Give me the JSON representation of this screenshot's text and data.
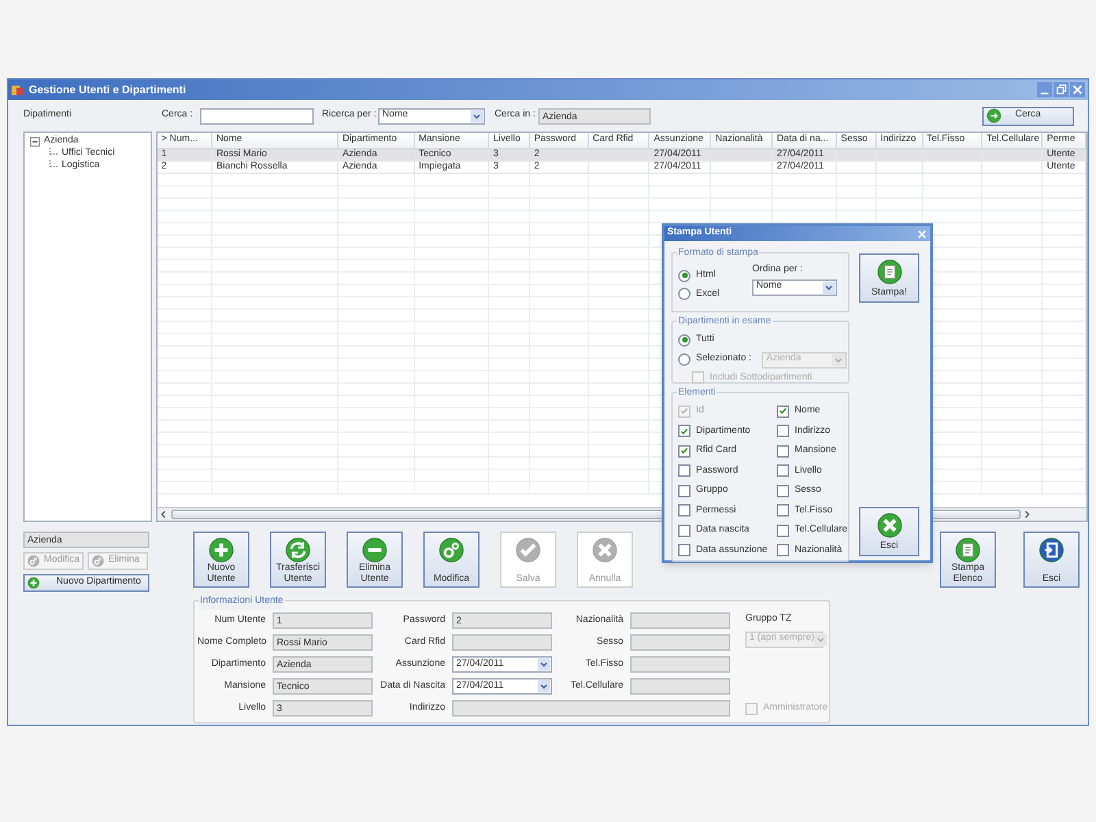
{
  "window": {
    "title": "Gestione Utenti e Dipartimenti"
  },
  "toolbar": {
    "departments_label": "Dipatimenti",
    "search_label": "Cerca :",
    "search_by_label": "Ricerca per :",
    "search_by_value": "Nome",
    "search_in_label": "Cerca in :",
    "search_in_value": "Azienda",
    "search_button": "Cerca"
  },
  "tree": [
    {
      "label": "Azienda",
      "expanded": true,
      "children": [
        {
          "label": "Uffici Tecnici"
        },
        {
          "label": "Logistica"
        }
      ]
    }
  ],
  "table": {
    "columns": [
      "> Num...",
      "Nome",
      "Dipartimento",
      "Mansione",
      "Livello",
      "Password",
      "Card Rfid",
      "Assunzione",
      "Nazionalità",
      "Data di na...",
      "Sesso",
      "Indirizzo",
      "Tel.Fisso",
      "Tel.Cellulare",
      "Perme"
    ],
    "rows": [
      {
        "selected": true,
        "cells": [
          "1",
          "Rossi Mario",
          "Azienda",
          "Tecnico",
          "3",
          "2",
          null,
          "27/04/2011",
          null,
          "27/04/2011",
          null,
          null,
          null,
          null,
          "Utente"
        ]
      },
      {
        "selected": false,
        "cells": [
          "2",
          "Bianchi Rossella",
          "Azienda",
          "Impiegata",
          "3",
          "2",
          null,
          "27/04/2011",
          null,
          "27/04/2011",
          null,
          null,
          null,
          null,
          "Utente"
        ]
      }
    ]
  },
  "department_panel": {
    "value": "Azienda",
    "buttons": [
      {
        "label": "Modifica",
        "disabled": true
      },
      {
        "label": "Elimina",
        "disabled": true
      },
      {
        "label": "Nuovo Dipartimento",
        "disabled": false
      }
    ]
  },
  "actions": [
    {
      "label": "Nuovo Utente",
      "kind": "plus",
      "disabled": false
    },
    {
      "label": "Trasferisci Utente",
      "kind": "swap",
      "disabled": false
    },
    {
      "label": "Elimina Utente",
      "kind": "minus",
      "disabled": false
    },
    {
      "label": "Modifica",
      "kind": "gear",
      "disabled": false
    },
    {
      "label": "Salva",
      "kind": "check",
      "disabled": true
    },
    {
      "label": "Annulla",
      "kind": "cross",
      "disabled": true
    }
  ],
  "right_actions": [
    {
      "label": "Stampa Elenco",
      "kind": "print",
      "disabled": false
    },
    {
      "label": "Esci",
      "kind": "exit",
      "disabled": false
    }
  ],
  "user_info": {
    "title": "Informazioni Utente",
    "column_1": [
      {
        "label": "Num Utente",
        "value": "1",
        "kind": "text"
      },
      {
        "label": "Nome Completo",
        "value": "Rossi Mario",
        "kind": "text"
      },
      {
        "label": "Dipartimento",
        "value": "Azienda",
        "kind": "text"
      },
      {
        "label": "Mansione",
        "value": "Tecnico",
        "kind": "text"
      },
      {
        "label": "Livello",
        "value": "3",
        "kind": "text"
      }
    ],
    "column_2": [
      {
        "label": "Password",
        "value": "2",
        "kind": "text"
      },
      {
        "label": "Card Rfid",
        "kind": "text"
      },
      {
        "label": "Assunzione",
        "value": "27/04/2011",
        "kind": "date"
      },
      {
        "label": "Data di Nascita",
        "value": "27/04/2011",
        "kind": "date"
      },
      {
        "label": "Indirizzo",
        "kind": "wide"
      }
    ],
    "column_3": [
      {
        "label": "Nazionalità",
        "kind": "text"
      },
      {
        "label": "Sesso",
        "kind": "text"
      },
      {
        "label": "Tel.Fisso",
        "kind": "text"
      },
      {
        "label": "Tel.Cellulare",
        "kind": "text"
      }
    ],
    "group_tz": {
      "label": "Gruppo TZ",
      "value": "1 (apri sempre)",
      "disabled": true
    },
    "admin": {
      "label": "Amministratore",
      "checked": false,
      "disabled": true
    }
  },
  "print_dialog": {
    "title": "Stampa Utenti",
    "format": {
      "title": "Formato di stampa",
      "options": [
        {
          "label": "Html",
          "selected": true
        },
        {
          "label": "Excel",
          "selected": false
        }
      ],
      "order_label": "Ordina per :",
      "order_value": "Nome"
    },
    "departments": {
      "title": "Dipartimenti in esame",
      "options": [
        {
          "label": "Tutti",
          "selected": true
        },
        {
          "label": "Selezionato :",
          "selected": false
        }
      ],
      "department_value": "Azienda",
      "department_disabled": true,
      "include_sub": {
        "label": "Includi Sottodipartimenti",
        "checked": false,
        "disabled": true
      }
    },
    "elements": {
      "title": "Elementi",
      "items": [
        {
          "label": "Id",
          "checked": true,
          "disabled": true
        },
        {
          "label": "Nome",
          "checked": true,
          "disabled": false
        },
        {
          "label": "Dipartimento",
          "checked": true,
          "disabled": false
        },
        {
          "label": "Indirizzo",
          "checked": false,
          "disabled": false
        },
        {
          "label": "Rfid Card",
          "checked": true,
          "disabled": false
        },
        {
          "label": "Mansione",
          "checked": false,
          "disabled": false
        },
        {
          "label": "Password",
          "checked": false,
          "disabled": false
        },
        {
          "label": "Livello",
          "checked": false,
          "disabled": false
        },
        {
          "label": "Gruppo",
          "checked": false,
          "disabled": false
        },
        {
          "label": "Sesso",
          "checked": false,
          "disabled": false
        },
        {
          "label": "Permessi",
          "checked": false,
          "disabled": false
        },
        {
          "label": "Tel.Fisso",
          "checked": false,
          "disabled": false
        },
        {
          "label": "Data nascita",
          "checked": false,
          "disabled": false
        },
        {
          "label": "Tel.Cellulare",
          "checked": false,
          "disabled": false
        },
        {
          "label": "Data assunzione",
          "checked": false,
          "disabled": false
        },
        {
          "label": "Nazionalità",
          "checked": false,
          "disabled": false
        }
      ]
    },
    "print_button": {
      "label": "Stampa!",
      "kind": "print"
    },
    "exit_button": {
      "label": "Esci",
      "kind": "cross"
    }
  }
}
